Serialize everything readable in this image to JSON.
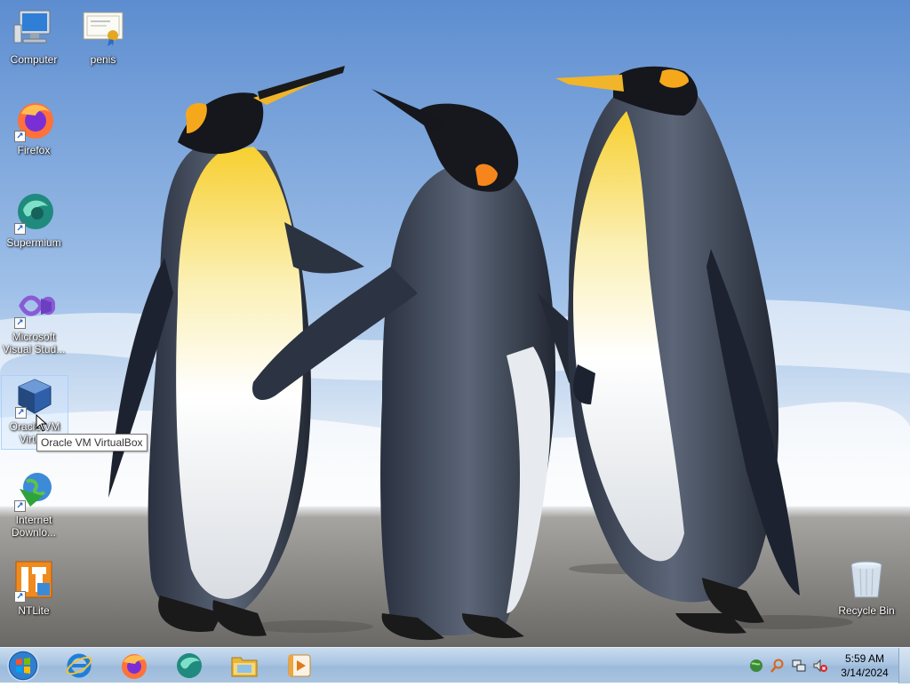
{
  "desktop": {
    "icons": [
      {
        "label": "Computer"
      },
      {
        "label": "penis"
      },
      {
        "label": "Firefox"
      },
      {
        "label": "Supermium"
      },
      {
        "label": "Microsoft Visual Stud..."
      },
      {
        "label": "Oracle VM Virtu..."
      },
      {
        "label": "Internet Downlo..."
      },
      {
        "label": "NTLite"
      },
      {
        "label": "Recycle Bin"
      }
    ],
    "tooltip": "Oracle VM VirtualBox"
  },
  "taskbar": {
    "pinned": [
      {
        "icon": "internet-explorer-icon"
      },
      {
        "icon": "firefox-icon"
      },
      {
        "icon": "supermium-icon"
      },
      {
        "icon": "file-explorer-icon"
      },
      {
        "icon": "media-player-icon"
      }
    ],
    "clock": {
      "time": "5:59 AM",
      "date": "3/14/2024"
    }
  },
  "colors": {
    "taskbar": "#aac5e2",
    "selection": "#c8e1ff",
    "sky": "#7ea8dc"
  }
}
